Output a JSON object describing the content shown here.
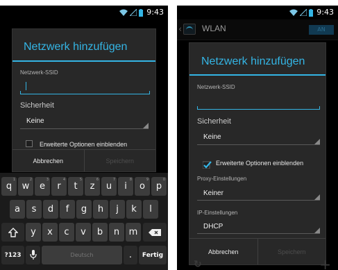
{
  "status": {
    "time": "9:43"
  },
  "left": {
    "dialog": {
      "title": "Netzwerk hinzufügen",
      "ssid_label": "Netzwerk-SSID",
      "ssid_value": "",
      "security_label": "Sicherheit",
      "security_value": "Keine",
      "advanced_label": "Erweiterte Optionen einblenden",
      "advanced_checked": false,
      "cancel_label": "Abbrechen",
      "save_label": "Speichern"
    },
    "keyboard": {
      "row1": [
        {
          "k": "q",
          "h": "1"
        },
        {
          "k": "w",
          "h": "2"
        },
        {
          "k": "e",
          "h": "3"
        },
        {
          "k": "r",
          "h": "4"
        },
        {
          "k": "t",
          "h": "5"
        },
        {
          "k": "z",
          "h": "6"
        },
        {
          "k": "u",
          "h": "7"
        },
        {
          "k": "i",
          "h": "8"
        },
        {
          "k": "o",
          "h": "9"
        },
        {
          "k": "p",
          "h": "0"
        }
      ],
      "row2": [
        "a",
        "s",
        "d",
        "f",
        "g",
        "h",
        "j",
        "k",
        "l"
      ],
      "row3": [
        "y",
        "x",
        "c",
        "v",
        "b",
        "n",
        "m"
      ],
      "symbols_label": "?123",
      "space_label": "Deutsch",
      "period_label": ".",
      "done_label": "Fertig"
    }
  },
  "right": {
    "actionbar": {
      "title": "WLAN",
      "switch_label": "AN"
    },
    "dialog": {
      "title": "Netzwerk hinzufügen",
      "ssid_label": "Netzwerk-SSID",
      "ssid_value": "",
      "security_label": "Sicherheit",
      "security_value": "Keine",
      "advanced_label": "Erweiterte Optionen einblenden",
      "advanced_checked": true,
      "proxy_label": "Proxy-Einstellungen",
      "proxy_value": "Keiner",
      "ip_label": "IP-Einstellungen",
      "ip_value": "DHCP",
      "cancel_label": "Abbrechen",
      "save_label": "Speichern"
    }
  },
  "colors": {
    "accent": "#34b5e5",
    "dialog_bg": "#282828",
    "key_bg": "#3c3c3c"
  },
  "icons": [
    "wifi-icon",
    "signal-icon",
    "battery-icon",
    "shift-icon",
    "backspace-icon",
    "microphone-icon",
    "checkbox-icon",
    "wifi-settings-icon"
  ]
}
